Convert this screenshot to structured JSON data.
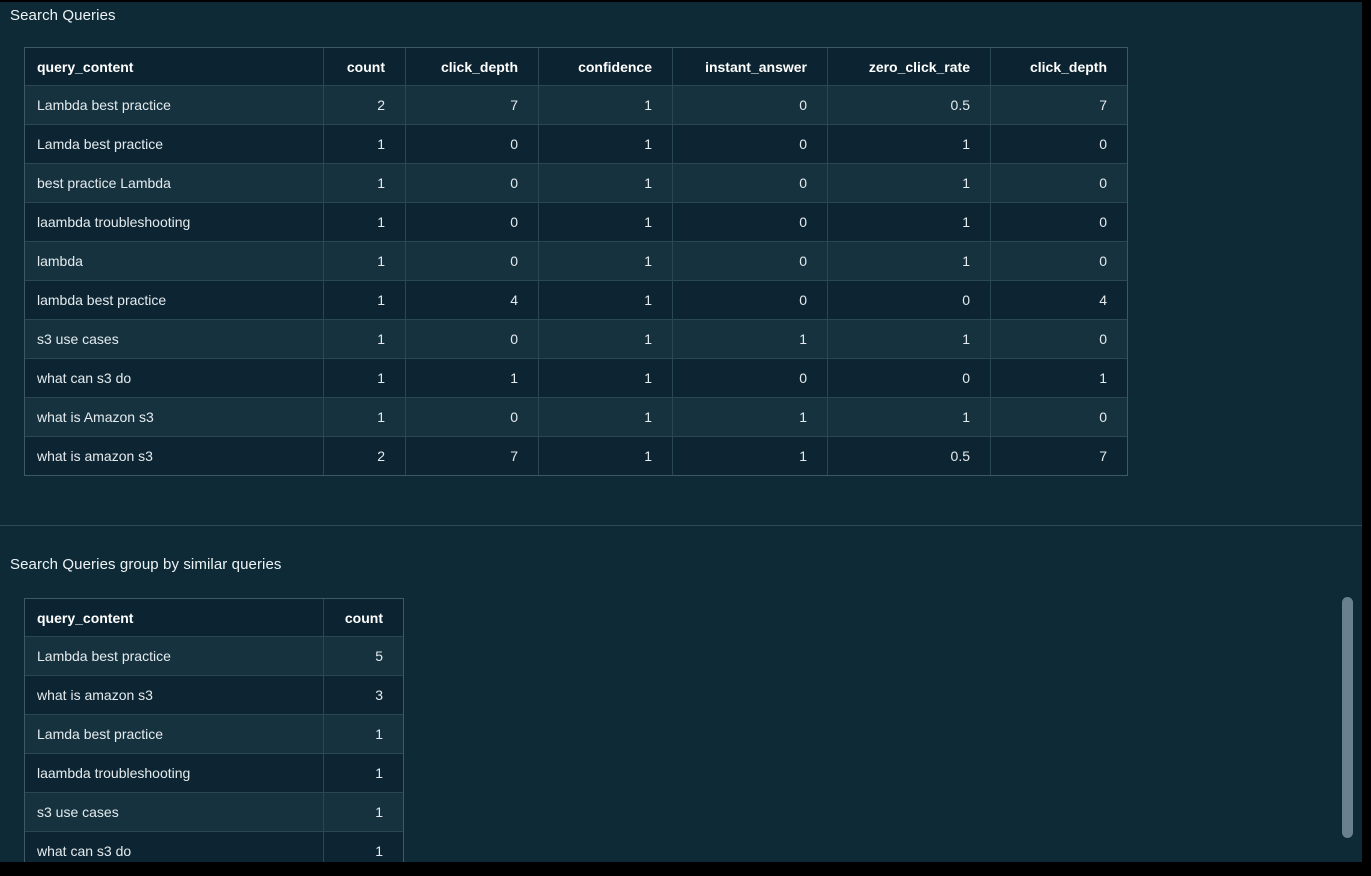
{
  "colors": {
    "background": "#0e2a37",
    "header_bg": "#0c2431",
    "row_odd_bg": "#16323f",
    "row_even_bg": "#0d2532",
    "border": "#2a4754",
    "divider": "#2e4b59",
    "text": "#e4ebee",
    "header_text": "#ffffff",
    "scrollbar_thumb": "#69808d"
  },
  "sections": [
    {
      "title": "Search Queries",
      "table": {
        "columns": [
          "query_content",
          "count",
          "click_depth",
          "confidence",
          "instant_answer",
          "zero_click_rate",
          "click_depth"
        ],
        "rows": [
          [
            "Lambda best practice",
            2,
            7,
            1,
            0,
            0.5,
            7
          ],
          [
            "Lamda best practice",
            1,
            0,
            1,
            0,
            1,
            0
          ],
          [
            "best practice Lambda",
            1,
            0,
            1,
            0,
            1,
            0
          ],
          [
            "laambda troubleshooting",
            1,
            0,
            1,
            0,
            1,
            0
          ],
          [
            "lambda",
            1,
            0,
            1,
            0,
            1,
            0
          ],
          [
            "lambda best practice",
            1,
            4,
            1,
            0,
            0,
            4
          ],
          [
            "s3 use cases",
            1,
            0,
            1,
            1,
            1,
            0
          ],
          [
            "what can s3 do",
            1,
            1,
            1,
            0,
            0,
            1
          ],
          [
            "what is Amazon s3",
            1,
            0,
            1,
            1,
            1,
            0
          ],
          [
            "what is amazon s3",
            2,
            7,
            1,
            1,
            0.5,
            7
          ]
        ]
      }
    },
    {
      "title": "Search Queries group by similar queries",
      "table": {
        "columns": [
          "query_content",
          "count"
        ],
        "rows": [
          [
            "Lambda best practice",
            5
          ],
          [
            "what is amazon s3",
            3
          ],
          [
            "Lamda best practice",
            1
          ],
          [
            "laambda troubleshooting",
            1
          ],
          [
            "s3 use cases",
            1
          ],
          [
            "what can s3 do",
            1
          ]
        ]
      }
    }
  ]
}
